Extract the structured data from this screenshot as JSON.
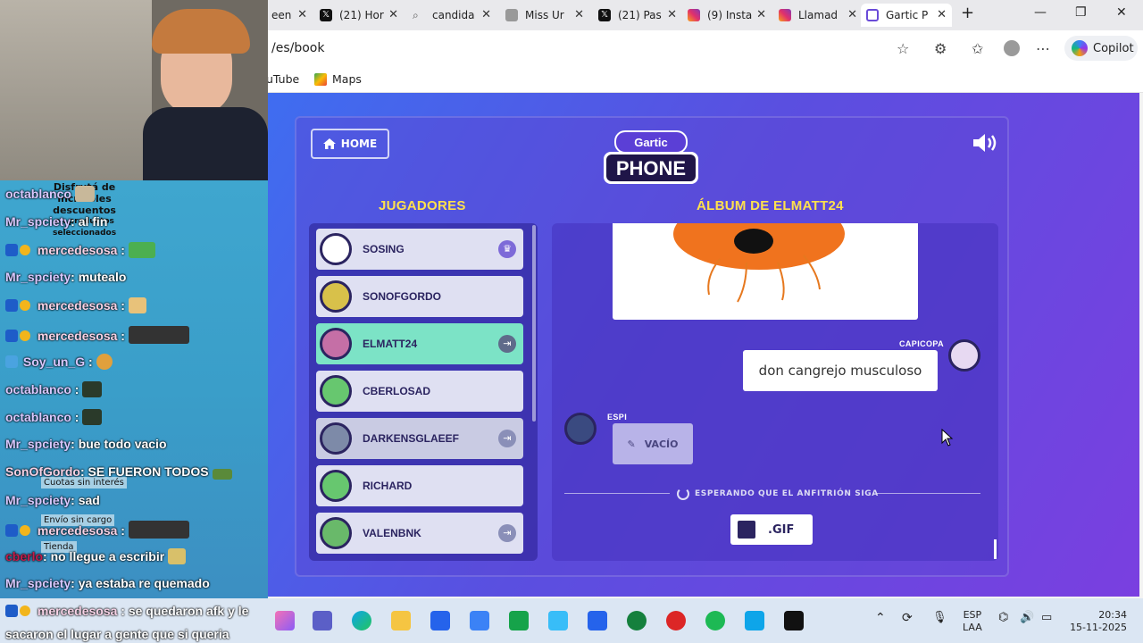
{
  "browser": {
    "tabs": [
      {
        "label": "een",
        "icon": "tab-icon"
      },
      {
        "label": "(21) Hor",
        "icon": "x-logo-icon"
      },
      {
        "label": "candida",
        "icon": "search-icon"
      },
      {
        "label": "Miss Ur",
        "icon": "page-icon"
      },
      {
        "label": "(21) Pas",
        "icon": "x-logo-icon"
      },
      {
        "label": "(9) Insta",
        "icon": "instagram-icon"
      },
      {
        "label": "Llamad",
        "icon": "instagram-icon"
      },
      {
        "label": "Gartic P",
        "icon": "gartic-icon",
        "active": true
      }
    ],
    "url": "/es/book",
    "copilot_label": "Copilot",
    "favorites": [
      {
        "label": "uTube",
        "icon": "youtube-icon"
      },
      {
        "label": "Maps",
        "icon": "maps-icon"
      }
    ]
  },
  "game": {
    "home_label": "HOME",
    "logo_top": "Gartic",
    "logo_bottom": "PHONE",
    "players_title": "JUGADORES",
    "album_title": "ÁLBUM DE ELMATT24",
    "players": [
      {
        "name": "SOSING",
        "badge": "crown",
        "me": false,
        "color": "#ffffff"
      },
      {
        "name": "SONOFGORDO",
        "badge": "",
        "me": false,
        "color": "#d8c14a"
      },
      {
        "name": "ELMATT24",
        "badge": "exit",
        "me": true,
        "color": "#c56fa6"
      },
      {
        "name": "CBERLOSAD",
        "badge": "",
        "me": false,
        "color": "#67c76f"
      },
      {
        "name": "DARKENSGLAEEF",
        "badge": "exit",
        "me": false,
        "color": "#7d8aa8"
      },
      {
        "name": "RICHARD",
        "badge": "",
        "me": false,
        "color": "#67c76f"
      },
      {
        "name": "VALENBNK",
        "badge": "exit",
        "me": false,
        "color": "#69b96a"
      }
    ],
    "album": {
      "sentence": "don cangrejo musculoso",
      "sentence_author": "CAPICOPA",
      "empty_author": "ESPI",
      "empty_label": "VACÍO",
      "waiting_text": "ESPERANDO QUE EL ANFITRIÓN SIGA",
      "gif_label": ".GIF"
    }
  },
  "chat": {
    "sponsor_text": [
      "Disfrutá de",
      "increíbles",
      "descuentos",
      "en productos",
      "seleccionados"
    ],
    "ads": [
      "Cuotas sin interés",
      "Envío sin cargo",
      "Tienda"
    ],
    "messages": [
      {
        "user": "octablanco",
        "text": "",
        "badges": false,
        "emote": true,
        "style": "normal"
      },
      {
        "user": "Mr_spciety",
        "text": ": al fin",
        "badges": false,
        "emote": false,
        "style": "normal"
      },
      {
        "user": "mercedesosa",
        "text": ":",
        "badges": true,
        "emote": true,
        "style": "pink"
      },
      {
        "user": "Mr_spciety",
        "text": ": mutealo",
        "badges": false,
        "emote": false,
        "style": "normal"
      },
      {
        "user": "mercedesosa",
        "text": ":",
        "badges": true,
        "emote": true,
        "style": "pink"
      },
      {
        "user": "mercedesosa",
        "text": ":",
        "badges": true,
        "emote": true,
        "style": "pink"
      },
      {
        "user": "Soy_un_G",
        "text": ":",
        "badges": true,
        "emote": true,
        "style": "normal"
      },
      {
        "user": "octablanco",
        "text": ":",
        "badges": false,
        "emote": true,
        "style": "normal"
      },
      {
        "user": "octablanco",
        "text": ":",
        "badges": false,
        "emote": true,
        "style": "normal"
      },
      {
        "user": "Mr_spciety",
        "text": ": bue todo vacio",
        "badges": false,
        "emote": false,
        "style": "normal"
      },
      {
        "user": "SonOfGordo",
        "text": ": SE FUERON TODOS",
        "badges": false,
        "emote": true,
        "style": "normal"
      },
      {
        "user": "Mr_spciety",
        "text": ": sad",
        "badges": false,
        "emote": false,
        "style": "normal"
      },
      {
        "user": "mercedesosa",
        "text": ":",
        "badges": true,
        "emote": true,
        "style": "pink"
      },
      {
        "user": "cberlo",
        "text": ": no llegue a escribir",
        "badges": false,
        "emote": true,
        "style": "cb"
      },
      {
        "user": "Mr_spciety",
        "text": ": ya estaba re quemado",
        "badges": false,
        "emote": false,
        "style": "normal"
      },
      {
        "user": "mercedesosa",
        "text": ": se quedaron afk y le",
        "badges": true,
        "emote": false,
        "style": "pink"
      },
      {
        "user": "",
        "text": "sacaron el lugar a gente que si queria",
        "badges": false,
        "emote": false,
        "style": "normal"
      }
    ]
  },
  "taskbar": {
    "lang_top": "ESP",
    "lang_bottom": "LAA",
    "time": "20:34",
    "date": "15-11-2025"
  }
}
